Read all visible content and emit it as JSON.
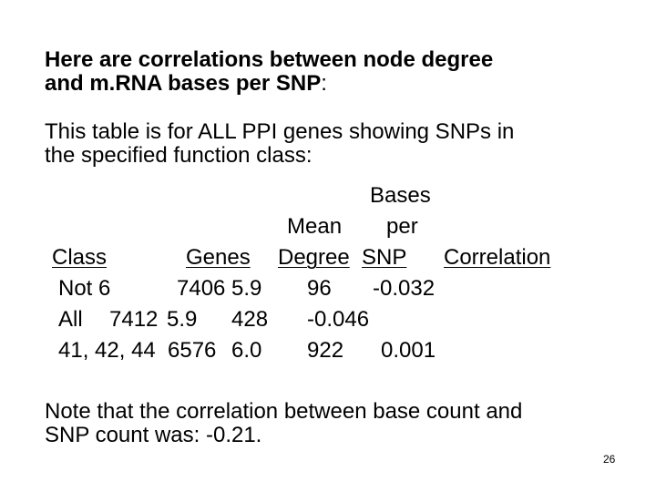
{
  "slide": {
    "title_line1": "Here are correlations between node degree",
    "title_line2": "and m.RNA bases per SNP",
    "title_colon": ":",
    "intro_line1": "This table is for ALL PPI genes showing SNPs in",
    "intro_line2": "the specified function class:",
    "table": {
      "header_top": {
        "bases": "Bases"
      },
      "header_mid": {
        "mean": "Mean",
        "per": "per"
      },
      "columns": [
        "Class",
        "Genes",
        "Degree",
        "SNP",
        "Correlation"
      ],
      "rows": [
        {
          "class": "Not 6",
          "genes": "7406",
          "degree": "5.9",
          "bases_per_snp": "96",
          "correlation": "-0.032"
        },
        {
          "class": "All",
          "genes": "7412",
          "degree": "5.9",
          "bases_per_snp": "428",
          "correlation": "-0.046"
        },
        {
          "class": "41, 42, 44",
          "genes": "6576",
          "degree": "6.0",
          "bases_per_snp": "922",
          "correlation": "0.001"
        }
      ]
    },
    "note_line1": "Note that the correlation between base count and",
    "note_line2": "SNP count was: -0.21.",
    "page_number": "26"
  }
}
